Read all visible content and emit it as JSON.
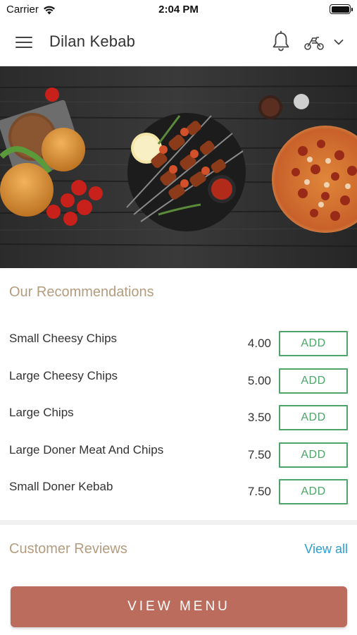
{
  "status_bar": {
    "carrier": "Carrier",
    "time": "2:04 PM",
    "battery_level": 1.0
  },
  "header": {
    "title": "Dilan Kebab",
    "menu_icon": "hamburger-icon",
    "notification_icon": "bell-icon",
    "mode_icon": "scooter-icon",
    "dropdown_icon": "chevron-down-icon"
  },
  "hero": {
    "description_icon": "food-banner-image"
  },
  "recommendations": {
    "title": "Our Recommendations",
    "add_label": "ADD",
    "items": [
      {
        "name": "Small Cheesy Chips",
        "price": "4.00"
      },
      {
        "name": "Large Cheesy Chips",
        "price": "5.00"
      },
      {
        "name": "Large Chips",
        "price": "3.50"
      },
      {
        "name": "Large Doner Meat And Chips",
        "price": "7.50"
      },
      {
        "name": "Small Doner Kebab",
        "price": "7.50"
      }
    ]
  },
  "reviews": {
    "title": "Customer Reviews",
    "view_all": "View all"
  },
  "footer": {
    "view_menu": "VIEW MENU"
  },
  "colors": {
    "accent_gold": "#b49c7e",
    "add_green": "#4ea368",
    "link_blue": "#2a9fd6",
    "button_terracotta": "#bb6c5c"
  }
}
